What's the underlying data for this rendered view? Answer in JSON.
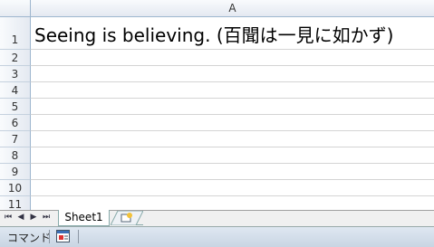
{
  "column_header": "A",
  "rows": [
    "1",
    "2",
    "3",
    "4",
    "5",
    "6",
    "7",
    "8",
    "9",
    "10",
    "11"
  ],
  "cell_a1": "Seeing is believing. (百聞は一見に如かず)",
  "sheet_tab": "Sheet1",
  "status": {
    "mode_label": "コマンド"
  },
  "colors": {
    "header_bg": "#e4e9f1",
    "grid_line": "#d4d4d4",
    "status_bg": "#c9d5e3"
  }
}
